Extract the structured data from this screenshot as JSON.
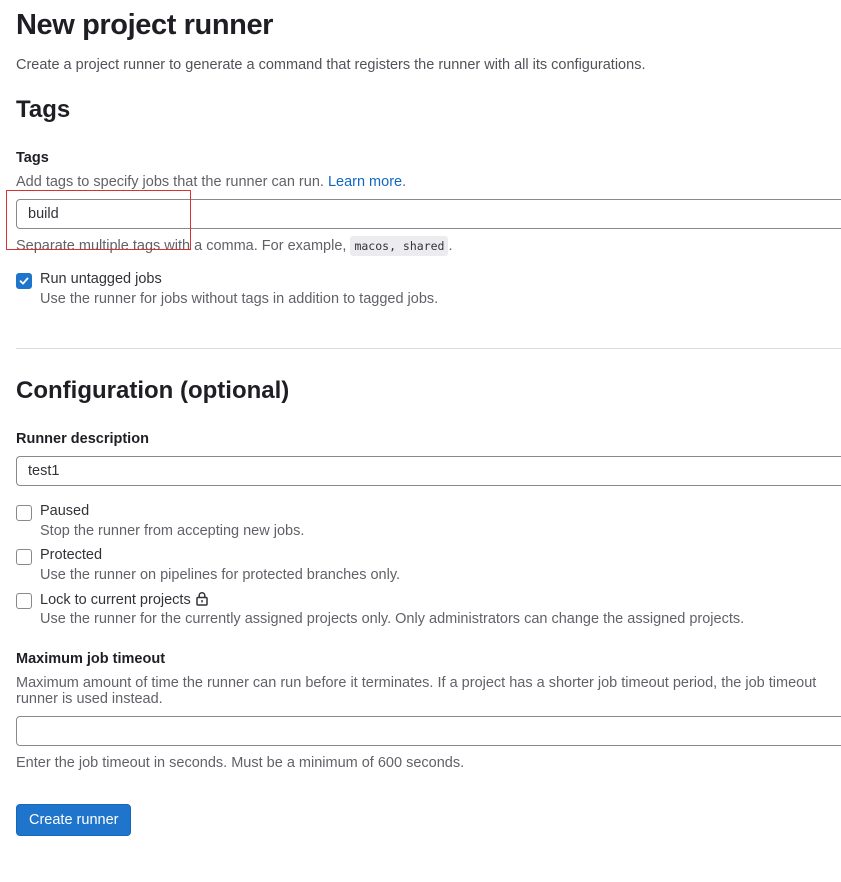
{
  "page": {
    "title": "New project runner",
    "subtitle": "Create a project runner to generate a command that registers the runner with all its configurations."
  },
  "tags_section": {
    "heading": "Tags",
    "field_label": "Tags",
    "help_text": "Add tags to specify jobs that the runner can run.",
    "learn_more": "Learn more",
    "learn_more_suffix": ".",
    "input_value": "build",
    "example_prefix": "Separate multiple tags with a comma. For example, ",
    "example_code": "macos, shared",
    "example_suffix": ".",
    "run_untagged": {
      "label": "Run untagged jobs",
      "help": "Use the runner for jobs without tags in addition to tagged jobs.",
      "checked": true
    }
  },
  "config_section": {
    "heading": "Configuration (optional)",
    "description_label": "Runner description",
    "description_value": "test1",
    "paused": {
      "label": "Paused",
      "help": "Stop the runner from accepting new jobs.",
      "checked": false
    },
    "protected": {
      "label": "Protected",
      "help": "Use the runner on pipelines for protected branches only.",
      "checked": false
    },
    "locked": {
      "label": "Lock to current projects",
      "help": "Use the runner for the currently assigned projects only. Only administrators can change the assigned projects.",
      "icon": "lock-icon",
      "checked": false
    },
    "timeout_label": "Maximum job timeout",
    "timeout_help_line1": "Maximum amount of time the runner can run before it terminates. If a project has a shorter job timeout period, the job timeout",
    "timeout_help_line2": "runner is used instead.",
    "timeout_value": "",
    "timeout_hint": "Enter the job timeout in seconds. Must be a minimum of 600 seconds."
  },
  "actions": {
    "create_label": "Create runner"
  },
  "colors": {
    "primary": "#1f75cb",
    "link": "#1068bf",
    "highlight_box": "#d93030"
  }
}
